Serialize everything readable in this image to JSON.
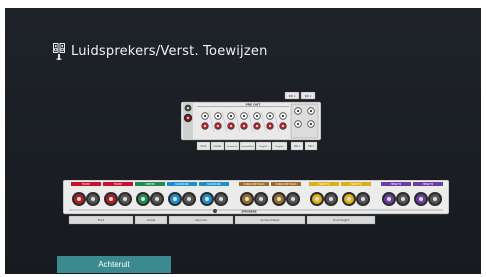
{
  "header": {
    "title": "Luidsprekers/Verst. Toewijzen"
  },
  "pre_out": {
    "heading": "PRE OUT",
    "channels": [
      "Front",
      "Center",
      "Surround",
      "Surround Back",
      "Height1",
      "Height2"
    ],
    "sw_labels": [
      "SW 1",
      "SW 2"
    ]
  },
  "speakers_panel": {
    "terminals": [
      "FRONT",
      "FRONT",
      "CENTER",
      "SURROUND",
      "SURROUND",
      "SURROUND BACK",
      "SURROUND BACK",
      "HEIGHT1",
      "HEIGHT1",
      "HEIGHT2",
      "HEIGHT2"
    ],
    "panel_label": "SPEAKERS",
    "groups": [
      "Front",
      "Center",
      "Surround",
      "Surround Back",
      "Front Height"
    ]
  },
  "footer": {
    "back_label": "Achteruit"
  },
  "colors": {
    "accent": "#3a8a8f",
    "front": "#c8102e",
    "center": "#1f8a4c",
    "surround": "#1d8fc9",
    "surround_back": "#9a6b2a",
    "height1": "#d9b21b",
    "height2": "#6b3fa0"
  }
}
